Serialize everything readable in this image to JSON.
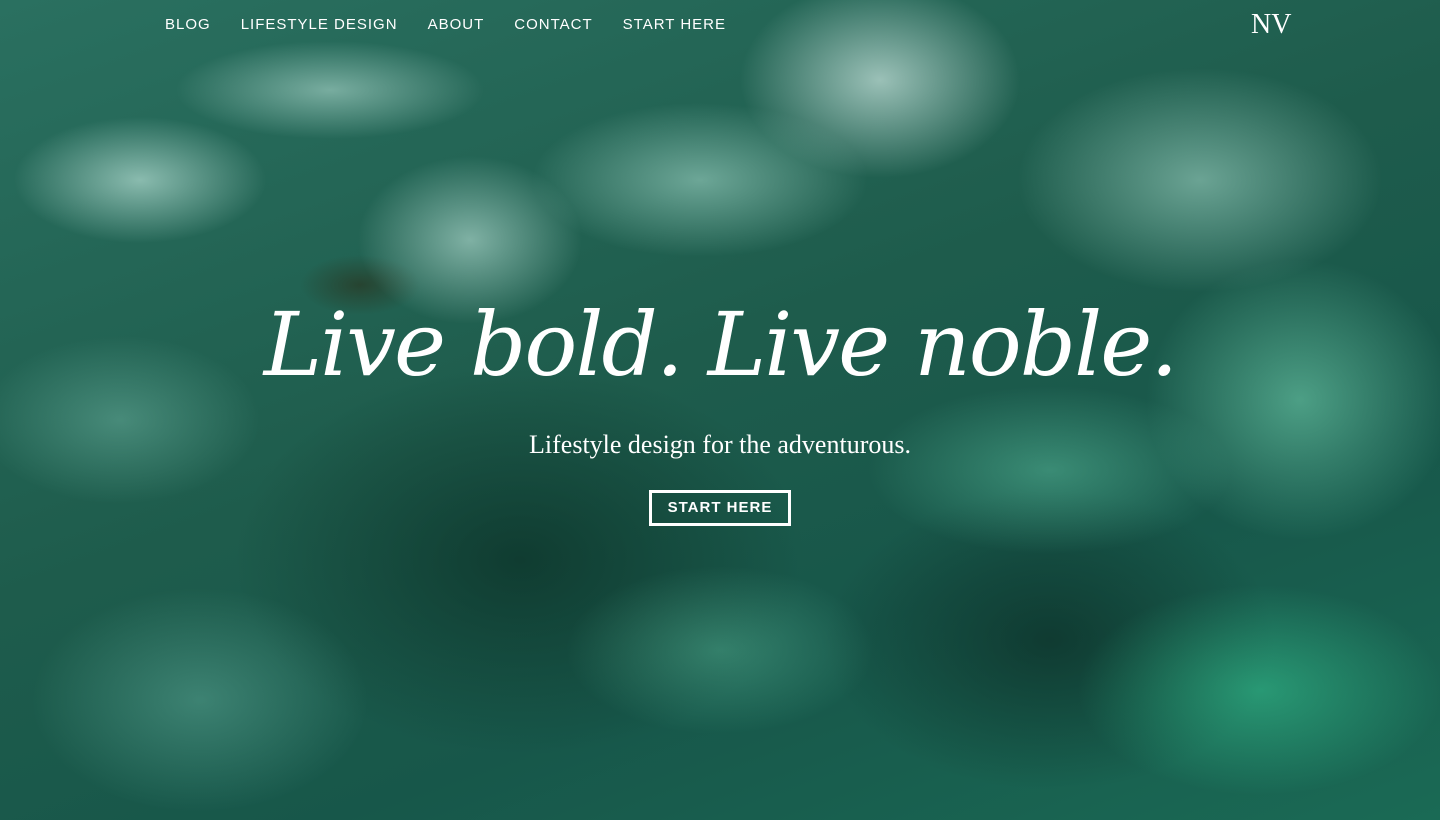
{
  "nav": {
    "items": [
      {
        "label": "BLOG"
      },
      {
        "label": "LIFESTYLE DESIGN"
      },
      {
        "label": "ABOUT"
      },
      {
        "label": "CONTACT"
      },
      {
        "label": "START HERE"
      }
    ]
  },
  "logo": {
    "text": "NV"
  },
  "hero": {
    "headline": "Live bold. Live noble.",
    "tagline": "Lifestyle design for the adventurous.",
    "cta_label": "START HERE",
    "background_image": "aerial-ocean-waves"
  },
  "colors": {
    "text": "#ffffff",
    "background": "#1d5a4a",
    "accent": "#2fc79a"
  }
}
